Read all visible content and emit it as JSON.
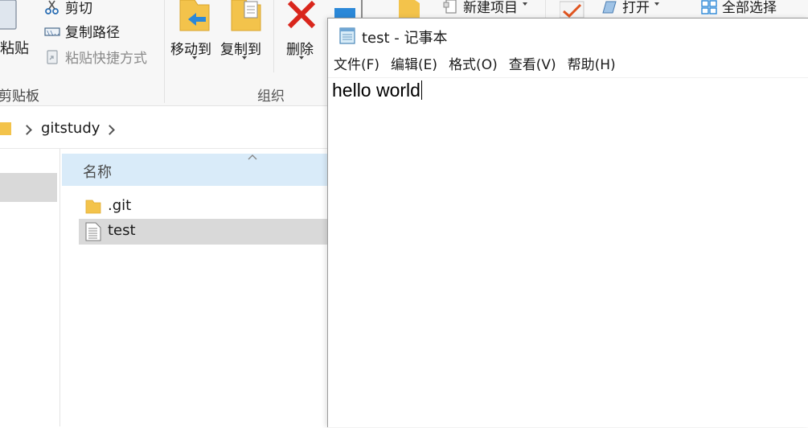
{
  "ribbon": {
    "clipboard": {
      "paste_label": "粘贴",
      "cut_label": "剪切",
      "copy_path_label": "复制路径",
      "paste_shortcut_label": "粘贴快捷方式",
      "group_label": "剪贴板"
    },
    "organize": {
      "move_to_label": "移动到",
      "copy_to_label": "复制到",
      "delete_label": "删除",
      "group_label": "组织"
    },
    "new": {
      "new_item_label": "新建项目"
    },
    "open": {
      "open_label": "打开"
    },
    "select": {
      "select_all_label": "全部选择"
    }
  },
  "address_bar": {
    "crumbs": [
      "gitstudy"
    ]
  },
  "file_list": {
    "column_name": "名称",
    "items": [
      {
        "name": ".git",
        "icon": "folder-icon",
        "selected": false
      },
      {
        "name": "test",
        "icon": "text-file-icon",
        "selected": true
      }
    ]
  },
  "notepad": {
    "title": "test - 记事本",
    "menus": [
      "文件(F)",
      "编辑(E)",
      "格式(O)",
      "查看(V)",
      "帮助(H)"
    ],
    "content": "hello world"
  },
  "colors": {
    "ribbon_bg": "#f7f7f7",
    "header_highlight": "#d9ebf9",
    "selection": "#d9d9d9",
    "delete_red": "#d9261c",
    "folder_yellow": "#f3c34b"
  }
}
